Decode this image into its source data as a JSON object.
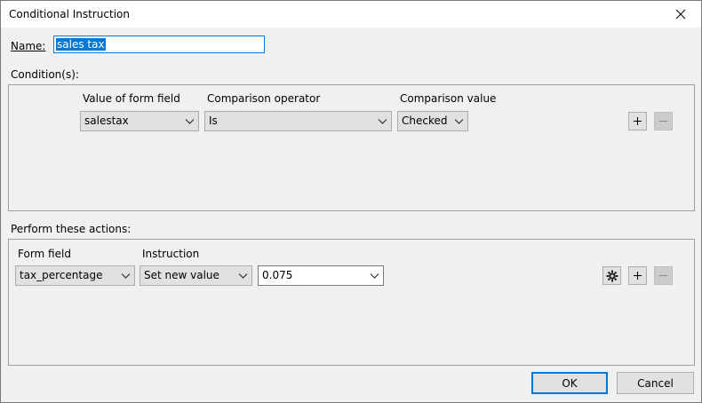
{
  "window": {
    "title": "Conditional Instruction"
  },
  "name_field": {
    "label": "Name:",
    "value": "sales tax"
  },
  "conditions": {
    "label": "Condition(s):",
    "headers": {
      "form_field": "Value of form field",
      "operator": "Comparison operator",
      "value": "Comparison value"
    },
    "row": {
      "form_field": "salestax",
      "operator": "Is",
      "value": "Checked"
    }
  },
  "actions": {
    "label": "Perform these actions:",
    "headers": {
      "form_field": "Form field",
      "instruction": "Instruction"
    },
    "row": {
      "form_field": "tax_percentage",
      "instruction": "Set new value",
      "value": "0.075"
    }
  },
  "buttons": {
    "ok": "OK",
    "cancel": "Cancel"
  },
  "icons": {
    "close": "close-icon",
    "add": "plus-icon",
    "remove": "minus-icon",
    "settings": "gear-icon",
    "dropdown": "chevron-down-icon"
  },
  "colors": {
    "accent": "#0078d7",
    "selection": "#0078d7"
  }
}
